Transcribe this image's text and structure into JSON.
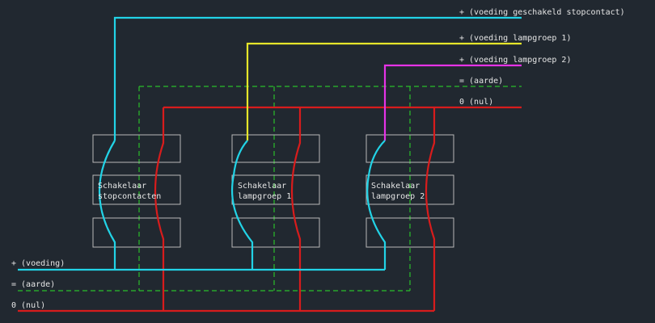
{
  "colors": {
    "background": "#212830",
    "supply_switched_outlet": "#22d3e6",
    "supply_lamp_group_1": "#e6e62a",
    "supply_lamp_group_2": "#e633e6",
    "neutral": "#d81c1c",
    "earth": "#2bbf2b",
    "box": "#b9b9b9",
    "text": "#e6e6e6"
  },
  "top_labels": {
    "switched_outlet": "+ (voeding geschakeld stopcontact)",
    "lamp_group_1": "+ (voeding lampgroep 1)",
    "lamp_group_2": "+ (voeding lampgroep 2)",
    "earth": "= (aarde)",
    "neutral": "0 (nul)"
  },
  "bottom_labels": {
    "supply": "+ (voeding)",
    "earth": "= (aarde)",
    "neutral": "0 (nul)"
  },
  "switches": [
    {
      "line1": "Schakelaar",
      "line2": "stopcontacten"
    },
    {
      "line1": "Schakelaar",
      "line2": "lampgroep 1"
    },
    {
      "line1": "Schakelaar",
      "line2": "lampgroep 2"
    }
  ]
}
